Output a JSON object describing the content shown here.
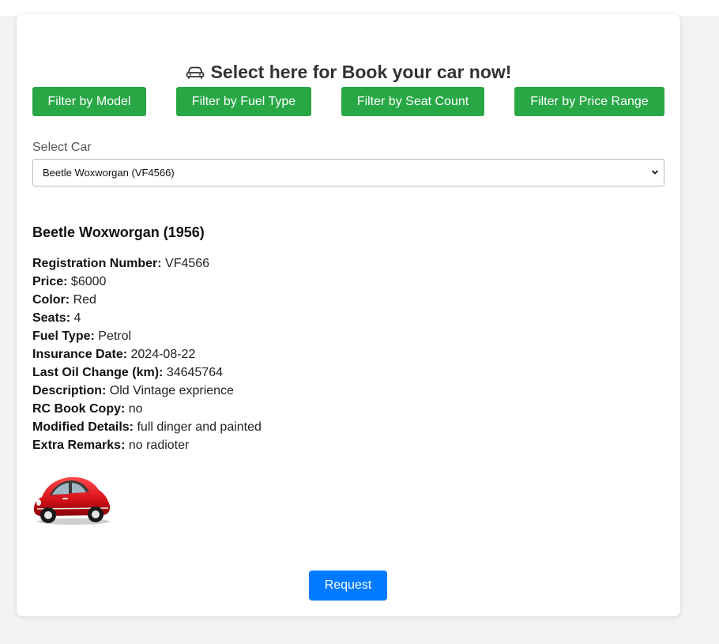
{
  "header": {
    "title": "Select here for Book your car now!",
    "icon": "car-icon"
  },
  "filters": {
    "model": "Filter by Model",
    "fuel": "Filter by Fuel Type",
    "seat": "Filter by Seat Count",
    "price": "Filter by Price Range"
  },
  "select": {
    "label": "Select Car",
    "value": "Beetle Woxworgan (VF4566)"
  },
  "car": {
    "heading": "Beetle Woxworgan (1956)",
    "details": [
      {
        "label": "Registration Number:",
        "value": "VF4566"
      },
      {
        "label": "Price:",
        "value": "$6000"
      },
      {
        "label": "Color:",
        "value": "Red"
      },
      {
        "label": "Seats:",
        "value": "4"
      },
      {
        "label": "Fuel Type:",
        "value": "Petrol"
      },
      {
        "label": "Insurance Date:",
        "value": "2024-08-22"
      },
      {
        "label": "Last Oil Change (km):",
        "value": "34645764"
      },
      {
        "label": "Description:",
        "value": "Old Vintage exprience"
      },
      {
        "label": "RC Book Copy:",
        "value": "no"
      },
      {
        "label": "Modified Details:",
        "value": "full dinger and painted"
      },
      {
        "label": "Extra Remarks:",
        "value": "no radioter"
      }
    ]
  },
  "actions": {
    "request": "Request"
  },
  "colors": {
    "filter_button": "#28a745",
    "request_button": "#007bff",
    "car_body": "#d8131b"
  }
}
